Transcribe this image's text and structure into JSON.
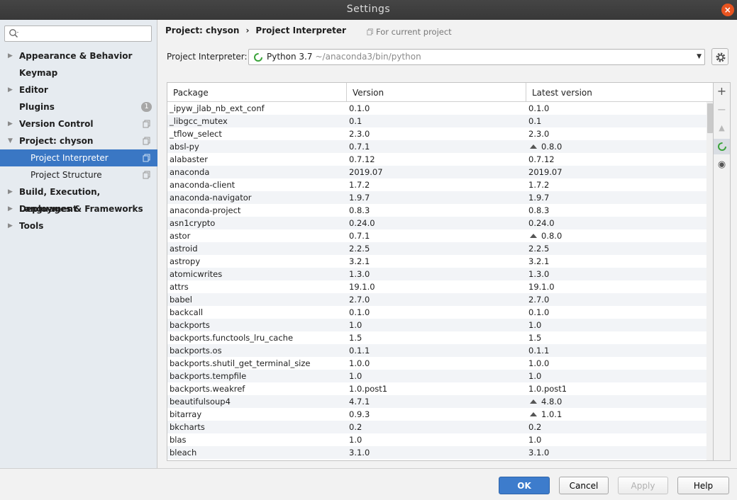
{
  "window": {
    "title": "Settings"
  },
  "sidebar": {
    "search_placeholder": "",
    "items": [
      {
        "label": "Appearance & Behavior",
        "arrow": "▶"
      },
      {
        "label": "Keymap",
        "arrow": ""
      },
      {
        "label": "Editor",
        "arrow": "▶"
      },
      {
        "label": "Plugins",
        "arrow": "",
        "badge": "1"
      },
      {
        "label": "Version Control",
        "arrow": "▶"
      },
      {
        "label": "Project: chyson",
        "arrow": "▼"
      },
      {
        "label": "Project Interpreter"
      },
      {
        "label": "Project Structure"
      },
      {
        "label": "Build, Execution, Deployment",
        "arrow": "▶"
      },
      {
        "label": "Languages & Frameworks",
        "arrow": "▶"
      },
      {
        "label": "Tools",
        "arrow": "▶"
      }
    ]
  },
  "header": {
    "crumb_parent": "Project: chyson",
    "crumb_sep": "›",
    "crumb_current": "Project Interpreter",
    "scope": "For current project"
  },
  "interpreter": {
    "label": "Project Interpreter:",
    "name": "Python 3.7",
    "path": "~/anaconda3/bin/python"
  },
  "table": {
    "columns": [
      "Package",
      "Version",
      "Latest version"
    ],
    "rows": [
      {
        "p": "_ipyw_jlab_nb_ext_conf",
        "v": "0.1.0",
        "l": "0.1.0",
        "up": false
      },
      {
        "p": "_libgcc_mutex",
        "v": "0.1",
        "l": "0.1",
        "up": false
      },
      {
        "p": "_tflow_select",
        "v": "2.3.0",
        "l": "2.3.0",
        "up": false
      },
      {
        "p": "absl-py",
        "v": "0.7.1",
        "l": "0.8.0",
        "up": true
      },
      {
        "p": "alabaster",
        "v": "0.7.12",
        "l": "0.7.12",
        "up": false
      },
      {
        "p": "anaconda",
        "v": "2019.07",
        "l": "2019.07",
        "up": false
      },
      {
        "p": "anaconda-client",
        "v": "1.7.2",
        "l": "1.7.2",
        "up": false
      },
      {
        "p": "anaconda-navigator",
        "v": "1.9.7",
        "l": "1.9.7",
        "up": false
      },
      {
        "p": "anaconda-project",
        "v": "0.8.3",
        "l": "0.8.3",
        "up": false
      },
      {
        "p": "asn1crypto",
        "v": "0.24.0",
        "l": "0.24.0",
        "up": false
      },
      {
        "p": "astor",
        "v": "0.7.1",
        "l": "0.8.0",
        "up": true
      },
      {
        "p": "astroid",
        "v": "2.2.5",
        "l": "2.2.5",
        "up": false
      },
      {
        "p": "astropy",
        "v": "3.2.1",
        "l": "3.2.1",
        "up": false
      },
      {
        "p": "atomicwrites",
        "v": "1.3.0",
        "l": "1.3.0",
        "up": false
      },
      {
        "p": "attrs",
        "v": "19.1.0",
        "l": "19.1.0",
        "up": false
      },
      {
        "p": "babel",
        "v": "2.7.0",
        "l": "2.7.0",
        "up": false
      },
      {
        "p": "backcall",
        "v": "0.1.0",
        "l": "0.1.0",
        "up": false
      },
      {
        "p": "backports",
        "v": "1.0",
        "l": "1.0",
        "up": false
      },
      {
        "p": "backports.functools_lru_cache",
        "v": "1.5",
        "l": "1.5",
        "up": false
      },
      {
        "p": "backports.os",
        "v": "0.1.1",
        "l": "0.1.1",
        "up": false
      },
      {
        "p": "backports.shutil_get_terminal_size",
        "v": "1.0.0",
        "l": "1.0.0",
        "up": false
      },
      {
        "p": "backports.tempfile",
        "v": "1.0",
        "l": "1.0",
        "up": false
      },
      {
        "p": "backports.weakref",
        "v": "1.0.post1",
        "l": "1.0.post1",
        "up": false
      },
      {
        "p": "beautifulsoup4",
        "v": "4.7.1",
        "l": "4.8.0",
        "up": true
      },
      {
        "p": "bitarray",
        "v": "0.9.3",
        "l": "1.0.1",
        "up": true
      },
      {
        "p": "bkcharts",
        "v": "0.2",
        "l": "0.2",
        "up": false
      },
      {
        "p": "blas",
        "v": "1.0",
        "l": "1.0",
        "up": false
      },
      {
        "p": "bleach",
        "v": "3.1.0",
        "l": "3.1.0",
        "up": false
      }
    ]
  },
  "toolbar": {
    "add": "+",
    "remove": "−",
    "upgrade": "▲",
    "eye": "◉"
  },
  "footer": {
    "ok": "OK",
    "cancel": "Cancel",
    "apply": "Apply",
    "help": "Help"
  }
}
